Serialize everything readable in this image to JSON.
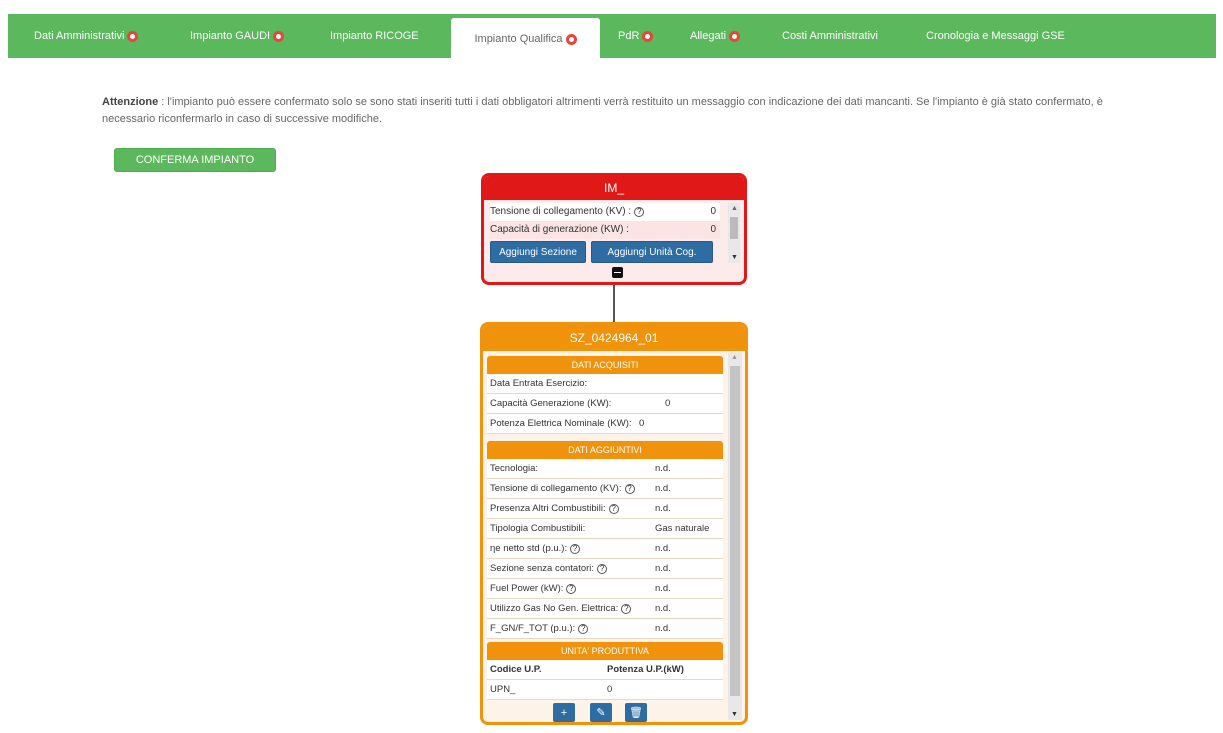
{
  "tabs": [
    {
      "label": "Dati Amministrativi",
      "error": true
    },
    {
      "label": "Impianto GAUDI",
      "error": true
    },
    {
      "label": "Impianto RICOGE",
      "error": false
    },
    {
      "label": "Impianto Qualifica",
      "error": true,
      "active": true
    },
    {
      "label": "PdR",
      "error": true
    },
    {
      "label": "Allegati",
      "error": true
    },
    {
      "label": "Costi Amministrativi",
      "error": false
    },
    {
      "label": "Cronologia e Messaggi GSE",
      "error": false
    }
  ],
  "attention": {
    "label": "Attenzione",
    "text": ": l'impianto può essere confermato solo se sono stati inseriti tutti i dati obbligatori altrimenti verrà restituito un messaggio con indicazione dei dati mancanti. Se l'impianto è già stato confermato, è necessario riconfermarlo in caso di successive modifiche."
  },
  "confirm_button": "CONFERMA IMPIANTO",
  "im_card": {
    "title": "IM_",
    "rows": [
      {
        "label": "Tensione di collegamento (KV) :",
        "value": "0",
        "help": true
      },
      {
        "label": "Capacità di generazione (KW) :",
        "value": "0",
        "help": false
      }
    ],
    "buttons": [
      "Aggiungi Sezione",
      "Aggiungi Unità Cog."
    ],
    "collapse_icon": "minus-icon"
  },
  "sz_card": {
    "title": "SZ_0424964_01",
    "dati_acquisiti": {
      "title": "DATI ACQUISITI",
      "rows": [
        {
          "label": "Data Entrata Esercizio:",
          "value": ""
        },
        {
          "label": "Capacità Generazione (KW):",
          "value": "0"
        },
        {
          "label": "Potenza Elettrica Nominale (KW):",
          "value": "0"
        }
      ]
    },
    "dati_aggiuntivi": {
      "title": "DATI AGGIUNTIVI",
      "rows": [
        {
          "label": "Tecnologia:",
          "value": "n.d.",
          "help": false
        },
        {
          "label": "Tensione di collegamento (KV):",
          "value": "n.d.",
          "help": true
        },
        {
          "label": "Presenza Altri Combustibili:",
          "value": "n.d.",
          "help": true
        },
        {
          "label": "Tipologia Combustibili:",
          "value": "Gas naturale",
          "help": false
        },
        {
          "label": "ηe netto std (p.u.):",
          "value": "n.d.",
          "help": true
        },
        {
          "label": "Sezione senza contatori:",
          "value": "n.d.",
          "help": true
        },
        {
          "label": "Fuel Power (kW):",
          "value": "n.d.",
          "help": true
        },
        {
          "label": "Utilizzo Gas No Gen. Elettrica:",
          "value": "n.d.",
          "help": true
        },
        {
          "label": "F_GN/F_TOT (p.u.):",
          "value": "n.d.",
          "help": true
        }
      ]
    },
    "unita_produttiva": {
      "title": "UNITA' PRODUTTIVA",
      "headers": [
        "Codice U.P.",
        "Potenza U.P.(kW)"
      ],
      "rows": [
        {
          "code": "UPN_",
          "power": "0"
        }
      ]
    },
    "action_icons": [
      "plus-icon",
      "edit-icon",
      "trash-icon"
    ]
  },
  "colors": {
    "tabbar": "#5cb85c",
    "im_border": "#e01818",
    "sz_border": "#f0920c",
    "button_blue": "#2e6da4"
  }
}
